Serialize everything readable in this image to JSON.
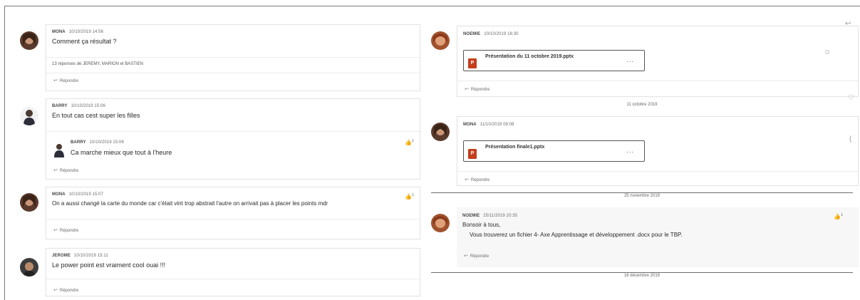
{
  "left_posts": [
    {
      "author": "MONA",
      "timestamp": "10/10/2019 14:56",
      "text": "Comment ça résultat ?",
      "replies_summary": "13 réponses de JEREMY, MARION et BASTIEN",
      "reply_label": "Répondre"
    },
    {
      "author": "BARRY",
      "timestamp": "10/10/2019 15:06",
      "text": "En tout cas cest super les filles",
      "nested": {
        "author": "BARRY",
        "timestamp": "10/10/2019 15:06",
        "text": "Ca marche mieux que tout à l'heure",
        "likes": "1"
      },
      "reply_label": "Répondre"
    },
    {
      "author": "MONA",
      "timestamp": "10/10/2019 15:07",
      "text": "On a aussi changé la carte du monde car c'était vint trop abstrait l'autre on arrivait pas à placer les points mdr",
      "likes": "1",
      "reply_label": "Répondre"
    },
    {
      "author": "JEROME",
      "timestamp": "10/10/2019 15:11",
      "text": "Le power point est vraiment cool ouai !!!",
      "reply_label": "Répondre"
    }
  ],
  "right_posts": [
    {
      "author": "NOEMIE",
      "timestamp": "10/10/2019 18:30",
      "file": "Présentation du 11 octobre 2019.pptx",
      "reply_label": "Répondre"
    },
    {
      "author": "MONA",
      "timestamp": "11/10/2019 09:08",
      "file": "Présentation finale1.pptx",
      "reply_label": "Répondre"
    },
    {
      "author": "NOEMIE",
      "timestamp": "25/11/2019 20:35",
      "text": "Bonsoir à tous,",
      "text2": "Vous trouverez un fichier 4- Axe Apprentissage et développement .docx pour le TBP.",
      "likes": "1",
      "reply_label": "Répondre"
    }
  ],
  "separators": [
    "11 octobre 2019",
    "25 novembre 2019",
    "16 décembre 2019"
  ],
  "file_more": "...",
  "colors": {
    "pptx": "#c43e1c",
    "like": "#f0b400"
  }
}
